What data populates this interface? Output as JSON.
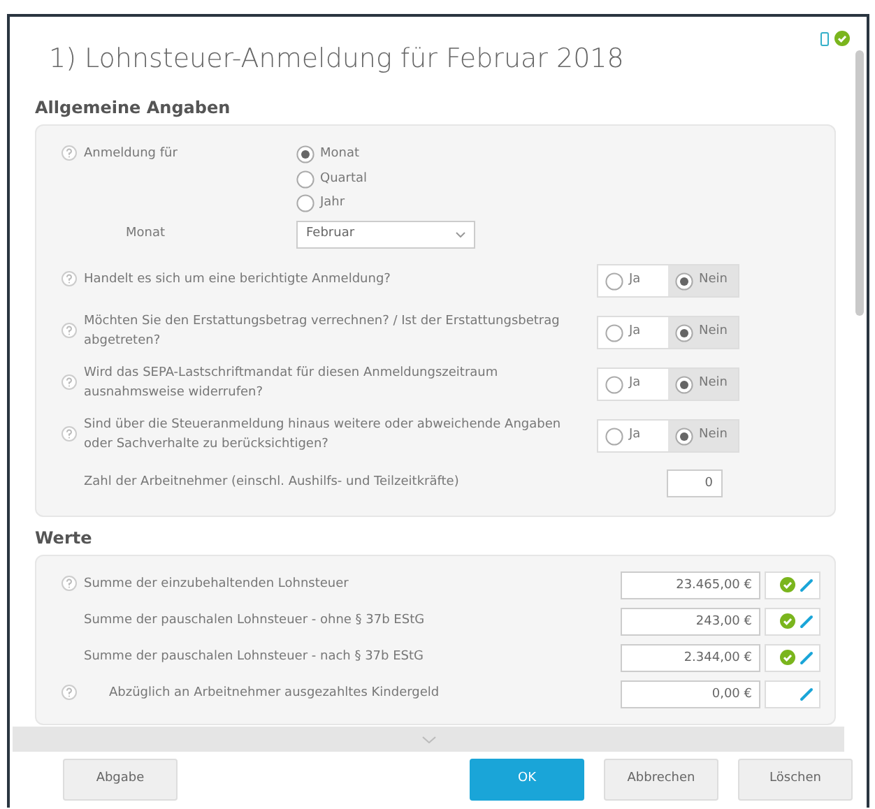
{
  "window": {
    "title": "1) Lohnsteuer-Anmeldung für Februar 2018"
  },
  "sections": [
    {
      "heading": "Allgemeine Angaben",
      "rows": [
        {
          "kind": "radio_group",
          "help": true,
          "label": "Anmeldung für",
          "options": [
            {
              "label": "Monat",
              "selected": true
            },
            {
              "label": "Quartal",
              "selected": false
            },
            {
              "label": "Jahr",
              "selected": false
            }
          ]
        },
        {
          "kind": "select",
          "help": false,
          "label": "Monat",
          "value": "Februar"
        },
        {
          "kind": "yes_no",
          "help": true,
          "label": "Handelt es sich um eine berichtigte Anmeldung?",
          "options": [
            {
              "label": "Ja",
              "selected": false
            },
            {
              "label": "Nein",
              "selected": true
            }
          ]
        },
        {
          "kind": "yes_no",
          "help": true,
          "label": "Möchten Sie den Erstattungsbetrag verrechnen? / Ist der Erstattungsbetrag abgetreten?",
          "options": [
            {
              "label": "Ja",
              "selected": false
            },
            {
              "label": "Nein",
              "selected": true
            }
          ]
        },
        {
          "kind": "yes_no",
          "help": true,
          "label": "Wird das SEPA-Lastschriftmandat für diesen Anmeldungszeitraum ausnahmsweise widerrufen?",
          "options": [
            {
              "label": "Ja",
              "selected": false
            },
            {
              "label": "Nein",
              "selected": true
            }
          ]
        },
        {
          "kind": "yes_no",
          "help": true,
          "label": "Sind über die Steueranmeldung hinaus weitere oder abweichende Angaben oder Sachverhalte zu berücksichtigen?",
          "options": [
            {
              "label": "Ja",
              "selected": false
            },
            {
              "label": "Nein",
              "selected": true
            }
          ]
        },
        {
          "kind": "number",
          "help": false,
          "label": "Zahl der Arbeitnehmer (einschl. Aushilfs- und Teilzeitkräfte)",
          "value": "0"
        }
      ]
    },
    {
      "heading": "Werte",
      "rows": [
        {
          "kind": "amount",
          "help": true,
          "label": "Summe der einzubehaltenden Lohnsteuer",
          "value": "23.465,00 €",
          "checked": true
        },
        {
          "kind": "amount",
          "help": false,
          "label": "Summe der pauschalen Lohnsteuer - ohne § 37b EStG",
          "value": "243,00 €",
          "checked": true
        },
        {
          "kind": "amount",
          "help": false,
          "label": "Summe der pauschalen Lohnsteuer - nach § 37b EStG",
          "value": "2.344,00 €",
          "checked": true
        },
        {
          "kind": "amount_sub",
          "help": true,
          "label": "Abzüglich an Arbeitnehmer ausgezahltes Kindergeld",
          "value": "0,00 €",
          "checked": false
        }
      ]
    }
  ],
  "buttons": [
    {
      "label": "Abgabe",
      "kind": "secondary"
    },
    {
      "label": "OK",
      "kind": "primary"
    },
    {
      "label": "Abbrechen",
      "kind": "secondary"
    },
    {
      "label": "Löschen",
      "kind": "secondary"
    }
  ]
}
